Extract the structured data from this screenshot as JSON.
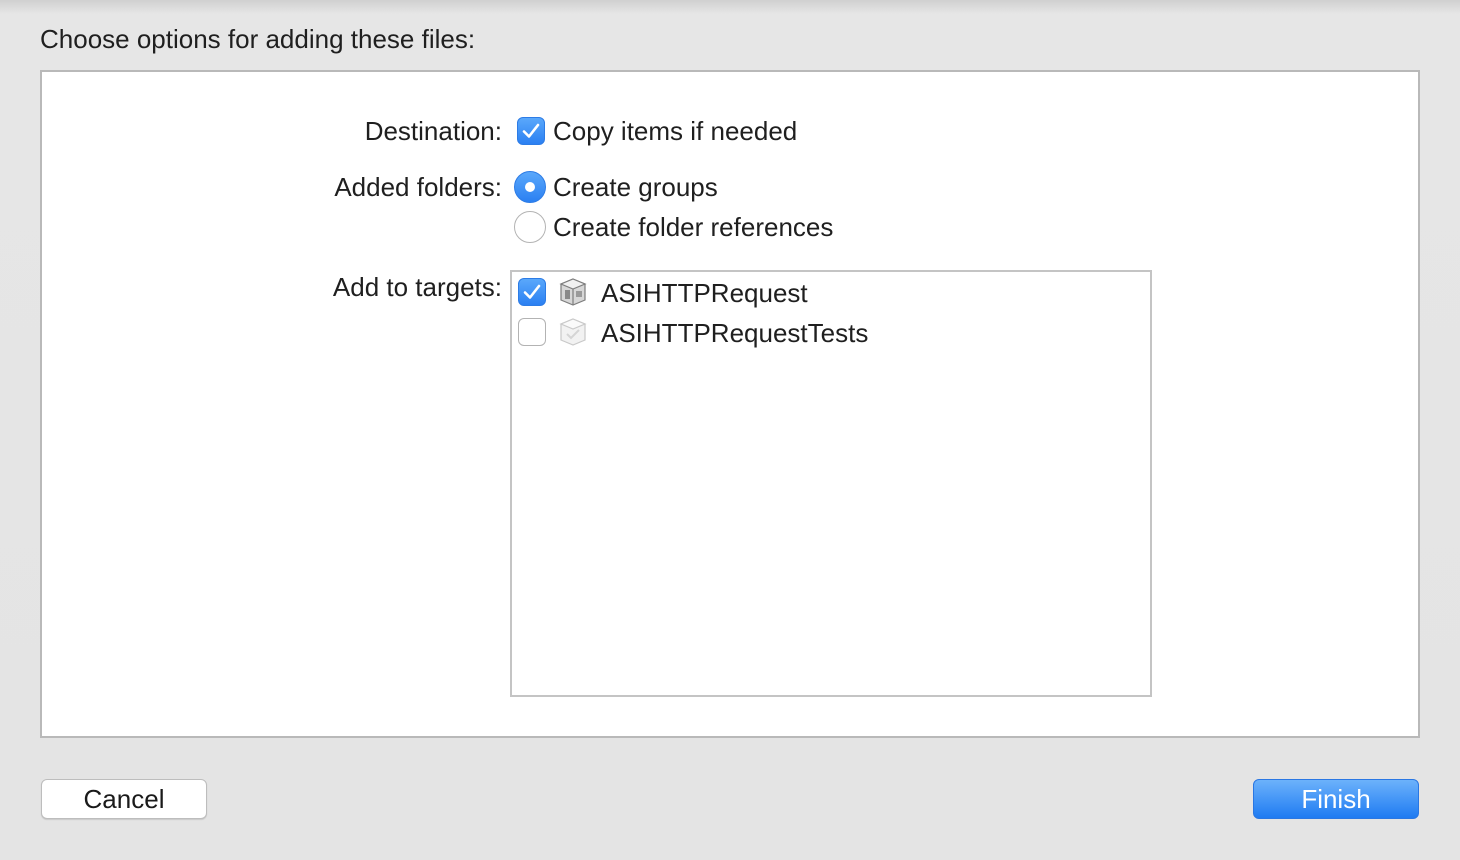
{
  "header": {
    "title": "Choose options for adding these files:"
  },
  "destination": {
    "label": "Destination:",
    "option": {
      "label": "Copy items if needed",
      "checked": true
    }
  },
  "added_folders": {
    "label": "Added folders:",
    "options": [
      {
        "label": "Create groups",
        "selected": true
      },
      {
        "label": "Create folder references",
        "selected": false
      }
    ]
  },
  "targets": {
    "label": "Add to targets:",
    "items": [
      {
        "name": "ASIHTTPRequest",
        "checked": true,
        "icon": "application-target-icon"
      },
      {
        "name": "ASIHTTPRequestTests",
        "checked": false,
        "icon": "test-bundle-icon"
      }
    ]
  },
  "buttons": {
    "cancel": "Cancel",
    "finish": "Finish"
  },
  "colors": {
    "accent": "#2b80f2",
    "panel_bg": "#ffffff",
    "window_bg": "#e4e4e4"
  }
}
